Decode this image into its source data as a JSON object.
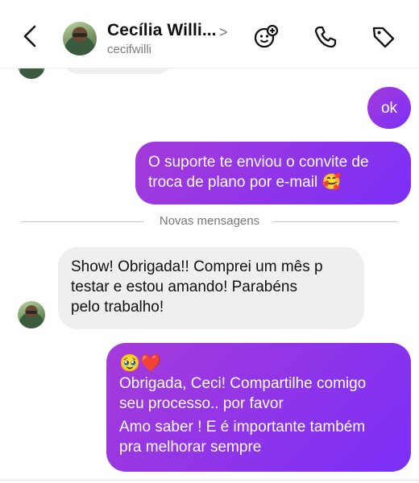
{
  "header": {
    "name": "Cecília Willi...",
    "chevron": ">",
    "handle": "cecifwilli",
    "icons": [
      "back-icon",
      "sticker-icon",
      "phone-icon",
      "tag-icon"
    ]
  },
  "messages": [
    {
      "id": "ok",
      "direction": "outgoing",
      "text": "ok"
    },
    {
      "id": "convite",
      "direction": "outgoing",
      "lines": [
        "O suporte te enviou o convite de",
        "troca de plano por e-mail 🥰"
      ]
    },
    {
      "id": "show",
      "direction": "incoming",
      "lines": [
        "Show! Obrigada!! Comprei um mês p",
        "testar e estou amando! Parabéns",
        "pelo trabalho!"
      ]
    },
    {
      "id": "reply",
      "direction": "outgoing",
      "lines": [
        "🥹❤️",
        "Obrigada, Ceci! Compartilhe comigo",
        "seu processo.. por favor",
        "Amo saber ! E é importante também",
        "pra melhorar sempre"
      ]
    }
  ],
  "divider": {
    "label": "Novas mensagens"
  },
  "colors": {
    "outgoing_start": "#a53bd9",
    "outgoing_end": "#7b2ff7",
    "incoming": "#efefef",
    "divider_text": "#777777"
  }
}
